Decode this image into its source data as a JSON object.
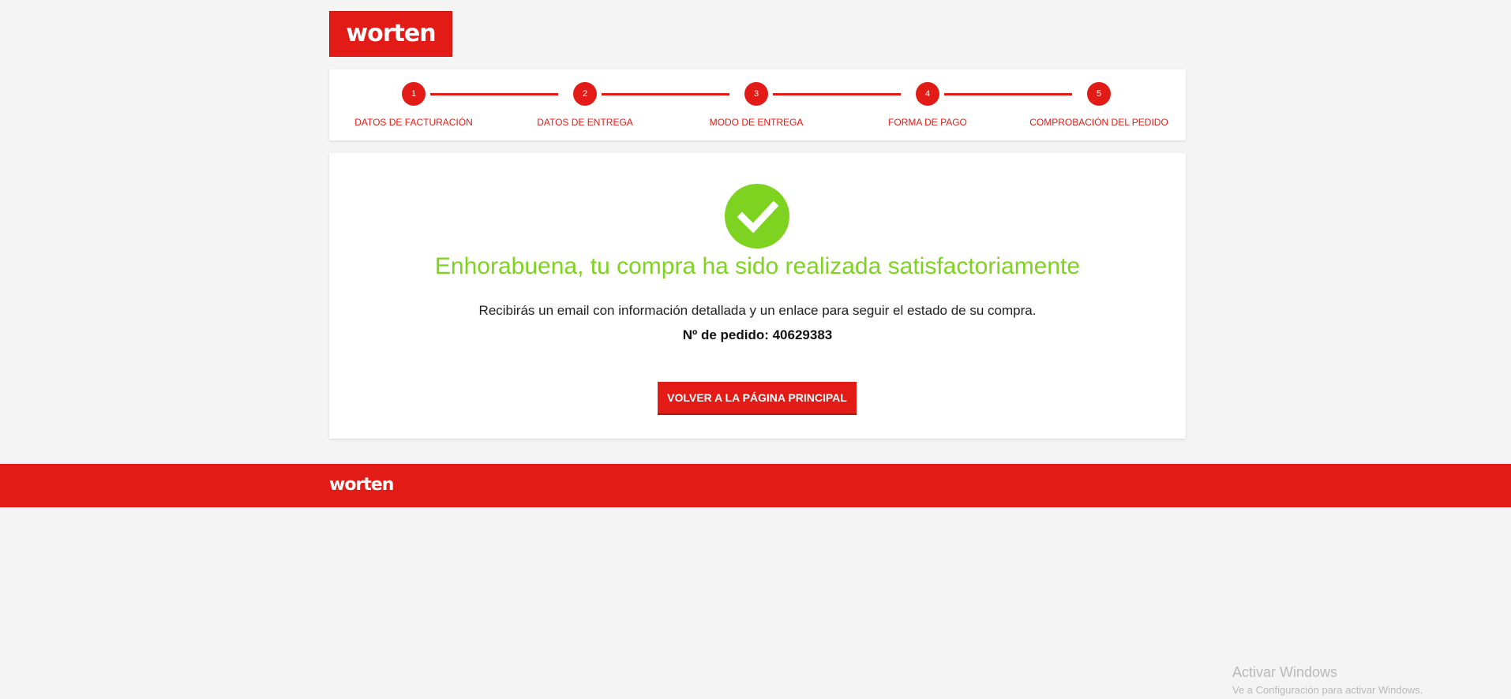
{
  "brand": {
    "logo_text": "worten",
    "color": "#e31b16"
  },
  "steps": [
    {
      "number": "1",
      "label": "DATOS DE FACTURACIÓN"
    },
    {
      "number": "2",
      "label": "DATOS DE ENTREGA"
    },
    {
      "number": "3",
      "label": "MODO DE ENTREGA"
    },
    {
      "number": "4",
      "label": "FORMA DE PAGO"
    },
    {
      "number": "5",
      "label": "COMPROBACIÓN DEL PEDIDO"
    }
  ],
  "confirmation": {
    "icon": "check-icon",
    "success_color": "#7ed321",
    "title": "Enhorabuena, tu compra ha sido realizada satisfactoriamente",
    "description": "Recibirás un email con información detallada y un enlace para seguir el estado de su compra.",
    "order_label": "Nº de pedido: 40629383",
    "button_label": "VOLVER A LA PÁGINA PRINCIPAL"
  },
  "footer": {
    "logo_text": "worten"
  },
  "watermark": {
    "title": "Activar Windows",
    "subtitle": "Ve a Configuración para activar Windows."
  }
}
